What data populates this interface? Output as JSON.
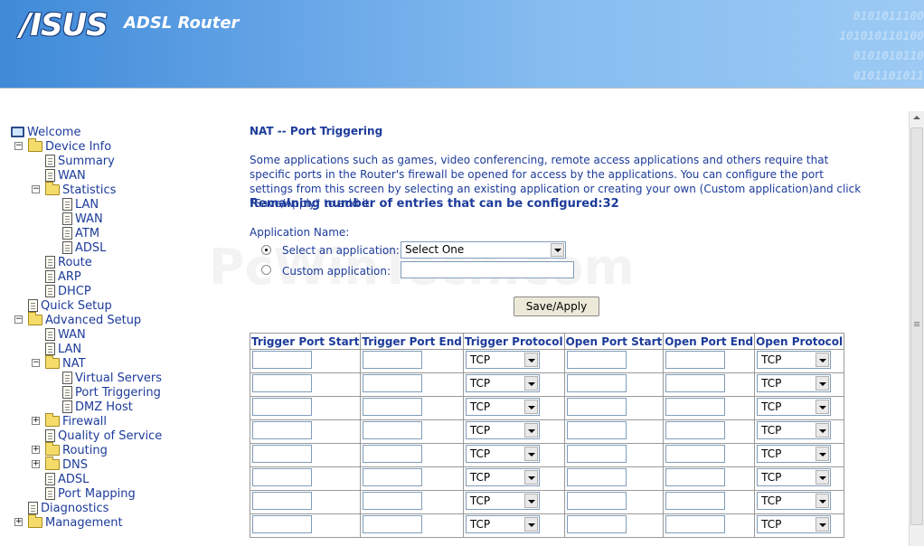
{
  "header": {
    "logo_text": "/ISUS",
    "product": "ADSL Router",
    "binary_lines": [
      "0101011100",
      "101010110100",
      "0101010110",
      "0101101011"
    ]
  },
  "tree": [
    {
      "label": "Welcome",
      "icon": "computer-icon",
      "toggle": ""
    },
    {
      "label": "Device Info",
      "icon": "folder-open-icon",
      "toggle": "−"
    },
    {
      "label": "Summary",
      "icon": "document-icon",
      "toggle": ""
    },
    {
      "label": "WAN",
      "icon": "document-icon",
      "toggle": ""
    },
    {
      "label": "Statistics",
      "icon": "folder-open-icon",
      "toggle": "−"
    },
    {
      "label": "LAN",
      "icon": "document-icon",
      "toggle": ""
    },
    {
      "label": "WAN",
      "icon": "document-icon",
      "toggle": ""
    },
    {
      "label": "ATM",
      "icon": "document-icon",
      "toggle": ""
    },
    {
      "label": "ADSL",
      "icon": "document-icon",
      "toggle": ""
    },
    {
      "label": "Route",
      "icon": "document-icon",
      "toggle": ""
    },
    {
      "label": "ARP",
      "icon": "document-icon",
      "toggle": ""
    },
    {
      "label": "DHCP",
      "icon": "document-icon",
      "toggle": ""
    },
    {
      "label": "Quick Setup",
      "icon": "document-icon",
      "toggle": ""
    },
    {
      "label": "Advanced Setup",
      "icon": "folder-open-icon",
      "toggle": "−"
    },
    {
      "label": "WAN",
      "icon": "document-icon",
      "toggle": ""
    },
    {
      "label": "LAN",
      "icon": "document-icon",
      "toggle": ""
    },
    {
      "label": "NAT",
      "icon": "folder-open-icon",
      "toggle": "−"
    },
    {
      "label": "Virtual Servers",
      "icon": "document-icon",
      "toggle": ""
    },
    {
      "label": "Port Triggering",
      "icon": "document-icon",
      "toggle": ""
    },
    {
      "label": "DMZ Host",
      "icon": "document-icon",
      "toggle": ""
    },
    {
      "label": "Firewall",
      "icon": "folder-icon",
      "toggle": "+"
    },
    {
      "label": "Quality of Service",
      "icon": "document-icon",
      "toggle": ""
    },
    {
      "label": "Routing",
      "icon": "folder-icon",
      "toggle": "+"
    },
    {
      "label": "DNS",
      "icon": "folder-icon",
      "toggle": "+"
    },
    {
      "label": "ADSL",
      "icon": "document-icon",
      "toggle": ""
    },
    {
      "label": "Port Mapping",
      "icon": "document-icon",
      "toggle": ""
    },
    {
      "label": "Diagnostics",
      "icon": "document-icon",
      "toggle": ""
    },
    {
      "label": "Management",
      "icon": "folder-icon",
      "toggle": "+"
    }
  ],
  "main": {
    "title": "NAT -- Port Triggering",
    "description": "Some applications such as games, video conferencing, remote access applications and others require that specific ports in the Router's firewall be opened for access by the applications. You can configure the port settings from this screen by selecting an existing application or creating your own (Custom application)and click \"Save/Apply\" to add it.",
    "remaining": "Remaining number of entries that can be configured:32",
    "app_name_label": "Application Name:",
    "select_app_label": "Select an application:",
    "select_app_value": "Select One",
    "custom_app_label": "Custom application:",
    "custom_app_value": "",
    "save_label": "Save/Apply",
    "watermark": "PcWinTech.com"
  },
  "table": {
    "headers": [
      "Trigger Port Start",
      "Trigger Port End",
      "Trigger Protocol",
      "Open Port Start",
      "Open Port End",
      "Open Protocol"
    ],
    "rows": [
      {
        "trigger_protocol": "TCP",
        "open_protocol": "TCP"
      },
      {
        "trigger_protocol": "TCP",
        "open_protocol": "TCP"
      },
      {
        "trigger_protocol": "TCP",
        "open_protocol": "TCP"
      },
      {
        "trigger_protocol": "TCP",
        "open_protocol": "TCP"
      },
      {
        "trigger_protocol": "TCP",
        "open_protocol": "TCP"
      },
      {
        "trigger_protocol": "TCP",
        "open_protocol": "TCP"
      },
      {
        "trigger_protocol": "TCP",
        "open_protocol": "TCP"
      },
      {
        "trigger_protocol": "TCP",
        "open_protocol": "TCP"
      }
    ]
  },
  "colors": {
    "link_text": "#1c3b9a",
    "banner": "#5b9be0"
  }
}
